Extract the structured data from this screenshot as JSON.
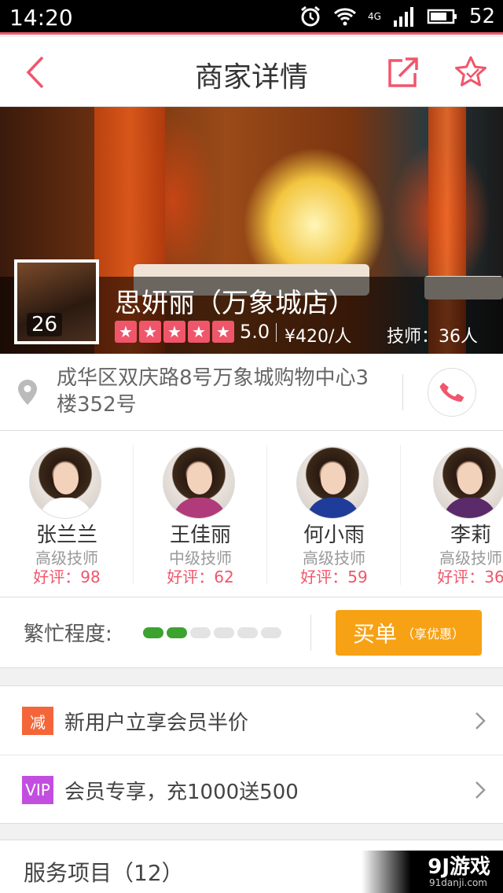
{
  "statusbar": {
    "time": "14:20",
    "network": "4G",
    "battery": "52"
  },
  "header": {
    "title": "商家详情"
  },
  "shop": {
    "photo_count": "26",
    "name": "思妍丽（万象城店）",
    "rating": "5.0",
    "stars_filled": 5,
    "price": "¥420/人",
    "technicians": "技师：36人",
    "address": "成华区双庆路8号万象城购物中心3楼352号"
  },
  "staff": [
    {
      "name": "张兰兰",
      "level": "高级技师",
      "score": "好评：98",
      "outfit_color": "#ffffff"
    },
    {
      "name": "王佳丽",
      "level": "中级技师",
      "score": "好评：62",
      "outfit_color": "#b13b7a"
    },
    {
      "name": "何小雨",
      "level": "高级技师",
      "score": "好评：59",
      "outfit_color": "#1f3c9a"
    },
    {
      "name": "李莉",
      "level": "高级技师",
      "score": "好评：36",
      "outfit_color": "#5a2a6a"
    }
  ],
  "busy": {
    "label": "繁忙程度:",
    "level": 2,
    "total": 6,
    "buy_label": "买单",
    "buy_sub": "（享优惠）"
  },
  "promos": [
    {
      "badge": "减",
      "text": "新用户立享会员半价",
      "color": "#f4663a"
    },
    {
      "badge": "VIP",
      "text": "会员专享，充1000送500",
      "color": "#c24ee0"
    }
  ],
  "services": {
    "title": "服务项目（12）"
  },
  "watermark": {
    "logo": "9J游戏",
    "url": "91danji.com"
  },
  "colors": {
    "accent": "#f0566b",
    "buy": "#f7a114",
    "busy_on": "#3ca330"
  }
}
